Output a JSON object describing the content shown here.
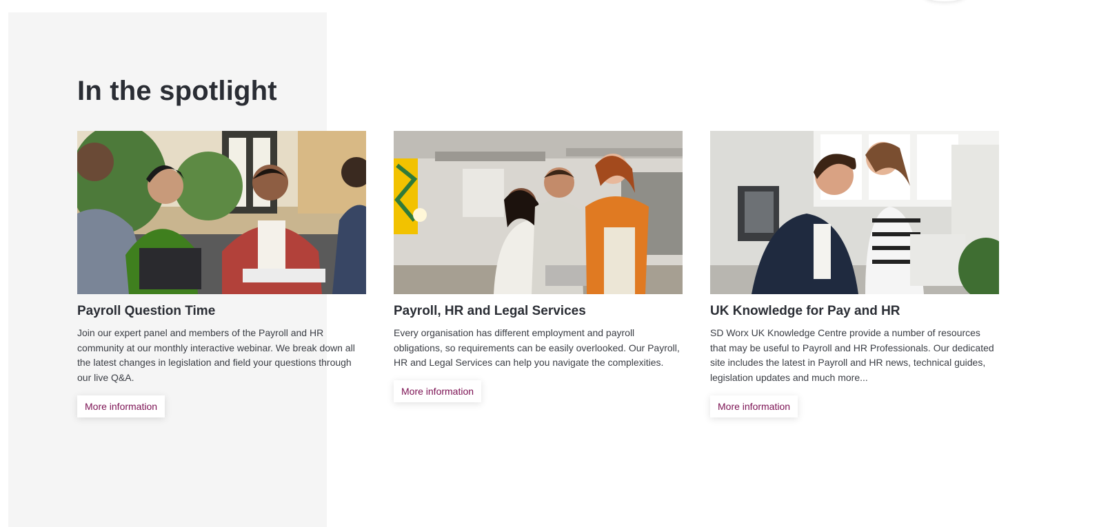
{
  "section": {
    "title": "In the spotlight"
  },
  "cards": [
    {
      "title": "Payroll Question Time",
      "text": "Join our expert panel and members of the Payroll and HR community at our monthly interactive webinar. We break down all the latest changes in legislation and field your questions through our live Q&A.",
      "button_label": "More information",
      "image_alt": "People in a meeting with laptops"
    },
    {
      "title": "Payroll, HR and Legal Services",
      "text": "Every organisation has different employment and payroll obligations, so requirements can be easily overlooked. Our Payroll, HR and Legal Services can help you navigate the complexities.",
      "button_label": "More information",
      "image_alt": "Colleagues gathered around a laptop in an office"
    },
    {
      "title": "UK Knowledge for Pay and HR",
      "text": "SD Worx UK Knowledge Centre provide a number of resources that may be useful to Payroll and HR Professionals. Our dedicated site includes the latest in Payroll and HR news, technical guides, legislation updates and much more...",
      "button_label": "More information",
      "image_alt": "Two people working at a computer"
    }
  ],
  "colors": {
    "accent": "#7b1052",
    "heading": "#2a2d34",
    "panel_bg": "#f5f5f5"
  }
}
